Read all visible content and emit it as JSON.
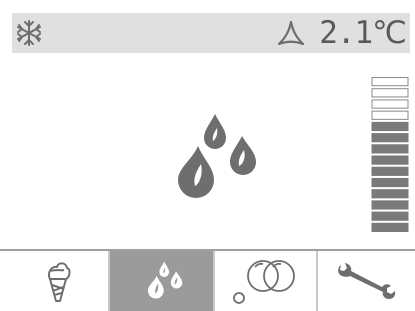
{
  "status": {
    "mode_icon": "snowflake-icon",
    "program_icon": "program-triangle-icon",
    "temperature": "2.1℃"
  },
  "main": {
    "icon": "water-drops-icon"
  },
  "level": {
    "segments_total": 14,
    "segments_filled": 10
  },
  "tabs": [
    {
      "name": "ice-cream",
      "icon": "ice-cream-cone-icon",
      "active": false
    },
    {
      "name": "drops",
      "icon": "water-drops-icon",
      "active": true
    },
    {
      "name": "bubbles",
      "icon": "bubbles-icon",
      "active": false
    },
    {
      "name": "settings",
      "icon": "wrench-icon",
      "active": false
    }
  ],
  "colors": {
    "icon": "#6e6e6e",
    "bar_fill": "#7a7a7a",
    "active_tab": "#9b9b9b",
    "topbar": "#e0e0e0"
  }
}
